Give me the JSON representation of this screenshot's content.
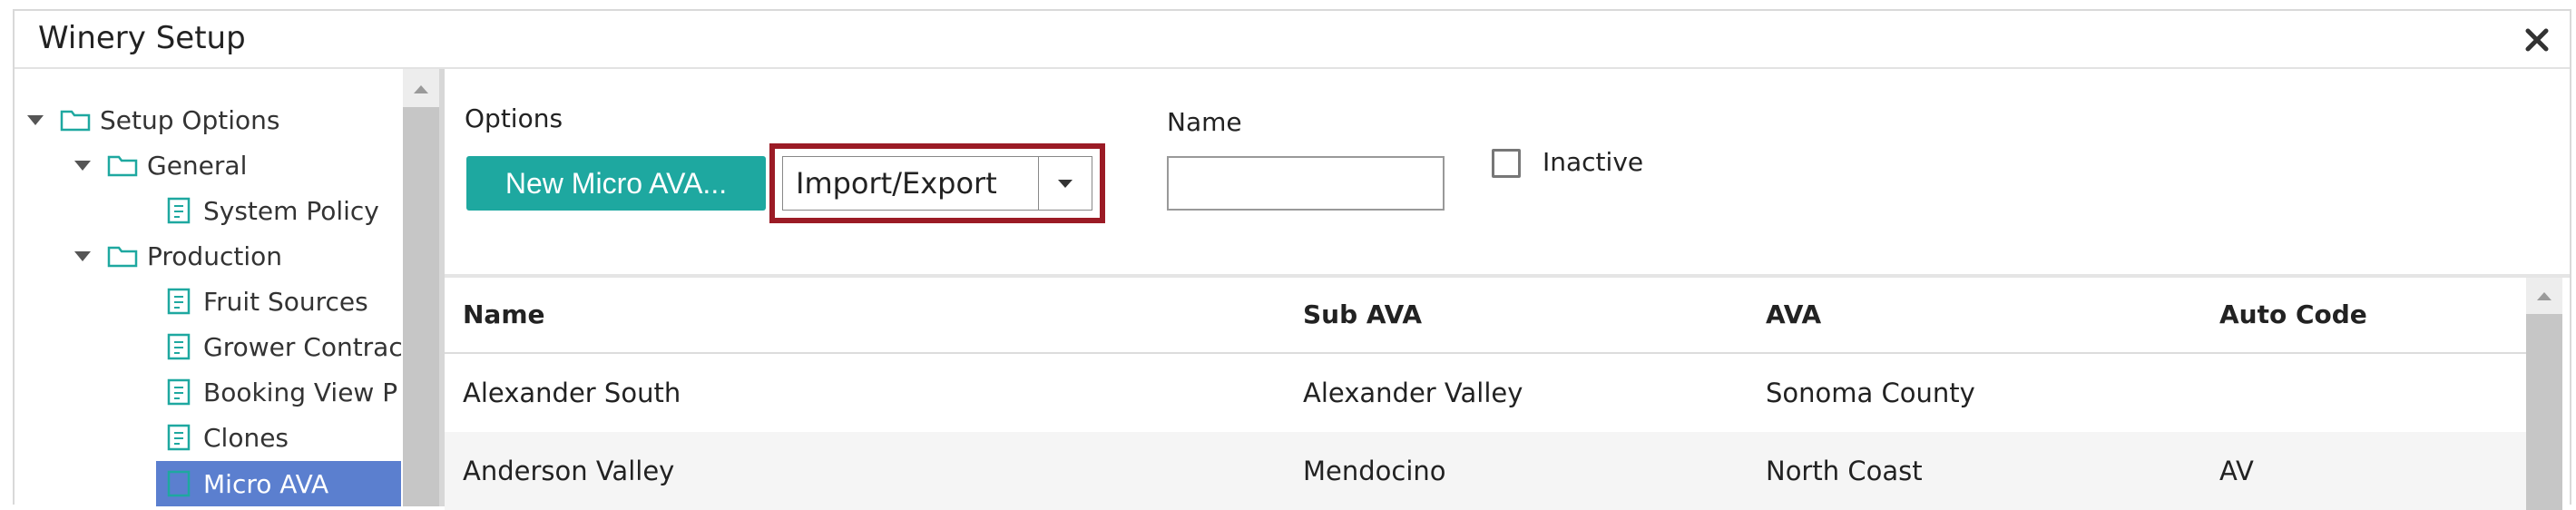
{
  "window": {
    "title": "Winery Setup"
  },
  "tree": {
    "root": "Setup Options",
    "general": "General",
    "system_policy": "System Policy",
    "production": "Production",
    "fruit_sources": "Fruit Sources",
    "grower_contracts": "Grower Contract",
    "booking_view": "Booking View P",
    "clones": "Clones",
    "micro_ava": "Micro AVA"
  },
  "toolbar": {
    "options_label": "Options",
    "new_button": "New Micro AVA...",
    "import_export": "Import/Export",
    "name_label": "Name",
    "name_value": "",
    "inactive_label": "Inactive"
  },
  "table": {
    "columns": [
      "Name",
      "Sub AVA",
      "AVA",
      "Auto Code"
    ],
    "rows": [
      [
        "Alexander South",
        "Alexander Valley",
        "Sonoma County",
        ""
      ],
      [
        "Anderson Valley",
        "Mendocino",
        "North Coast",
        "AV"
      ]
    ]
  },
  "colors": {
    "accent": "#1ea8a0",
    "selection": "#5b7fcf",
    "highlight": "#9b1b25"
  }
}
